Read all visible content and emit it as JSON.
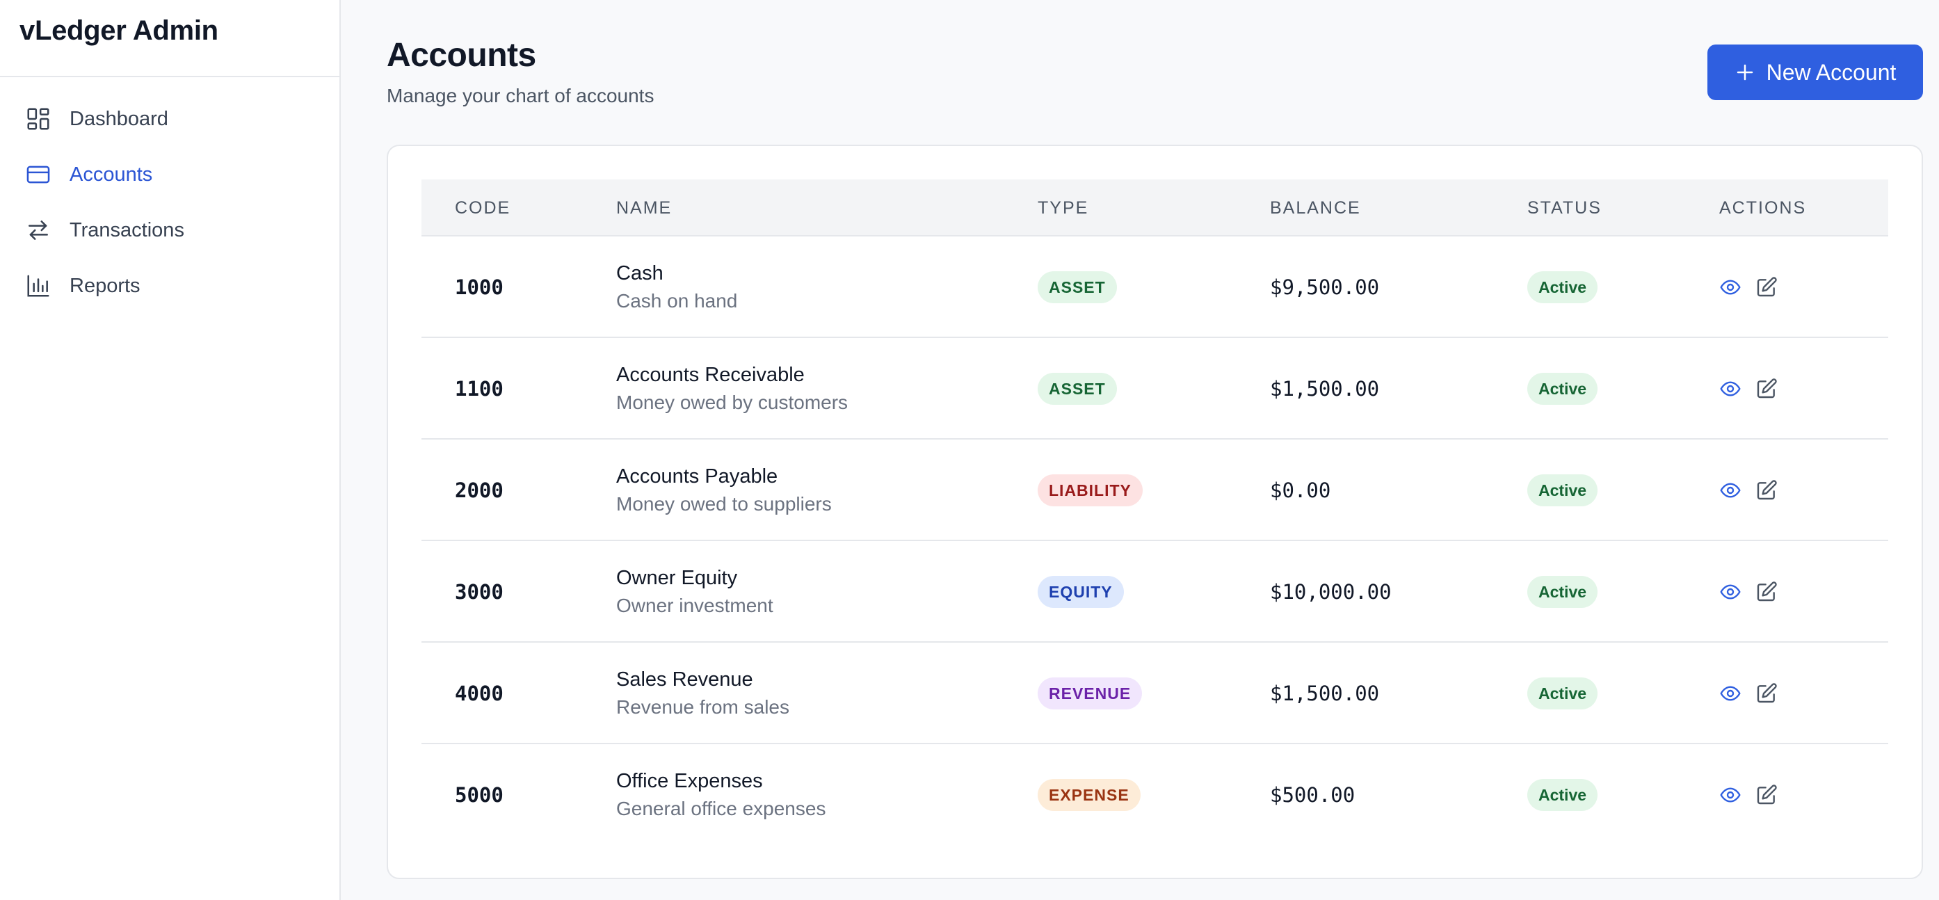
{
  "app": {
    "title": "vLedger Admin"
  },
  "sidebar": {
    "items": [
      {
        "label": "Dashboard",
        "icon": "dashboard-icon",
        "active": false
      },
      {
        "label": "Accounts",
        "icon": "credit-card-icon",
        "active": true
      },
      {
        "label": "Transactions",
        "icon": "arrows-swap-icon",
        "active": false
      },
      {
        "label": "Reports",
        "icon": "bar-chart-icon",
        "active": false
      }
    ]
  },
  "header": {
    "title": "Accounts",
    "subtitle": "Manage your chart of accounts",
    "new_button_label": "New Account"
  },
  "table": {
    "columns": {
      "code": "CODE",
      "name": "NAME",
      "type": "TYPE",
      "balance": "BALANCE",
      "status": "STATUS",
      "actions": "ACTIONS"
    },
    "rows": [
      {
        "code": "1000",
        "name": "Cash",
        "description": "Cash on hand",
        "type": "ASSET",
        "balance": "$9,500.00",
        "status": "Active"
      },
      {
        "code": "1100",
        "name": "Accounts Receivable",
        "description": "Money owed by customers",
        "type": "ASSET",
        "balance": "$1,500.00",
        "status": "Active"
      },
      {
        "code": "2000",
        "name": "Accounts Payable",
        "description": "Money owed to suppliers",
        "type": "LIABILITY",
        "balance": "$0.00",
        "status": "Active"
      },
      {
        "code": "3000",
        "name": "Owner Equity",
        "description": "Owner investment",
        "type": "EQUITY",
        "balance": "$10,000.00",
        "status": "Active"
      },
      {
        "code": "4000",
        "name": "Sales Revenue",
        "description": "Revenue from sales",
        "type": "REVENUE",
        "balance": "$1,500.00",
        "status": "Active"
      },
      {
        "code": "5000",
        "name": "Office Expenses",
        "description": "General office expenses",
        "type": "EXPENSE",
        "balance": "$500.00",
        "status": "Active"
      }
    ]
  },
  "colors": {
    "accent": "#2f5fe0",
    "nav_active": "#2b55d4",
    "type_badges": {
      "ASSET": {
        "bg": "#e3f6e8",
        "fg": "#166534"
      },
      "LIABILITY": {
        "bg": "#fde2e2",
        "fg": "#991b1b"
      },
      "EQUITY": {
        "bg": "#dde8fd",
        "fg": "#1e40af"
      },
      "REVENUE": {
        "bg": "#f1e6fd",
        "fg": "#6b21a8"
      },
      "EXPENSE": {
        "bg": "#fdecd8",
        "fg": "#9a3412"
      }
    }
  }
}
